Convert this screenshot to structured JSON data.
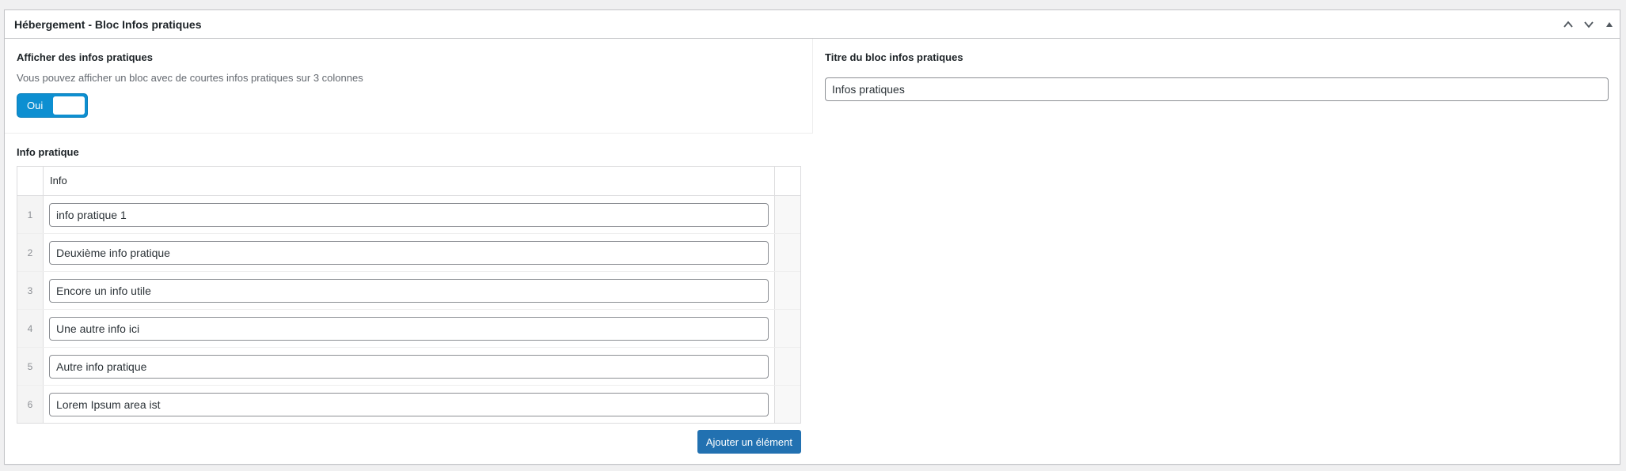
{
  "postbox": {
    "title": "Hébergement - Bloc Infos pratiques"
  },
  "toggle_field": {
    "label": "Afficher des infos pratiques",
    "description": "Vous pouvez afficher un bloc avec de courtes infos pratiques sur 3 colonnes",
    "on_text": "Oui",
    "checked": true
  },
  "title_field": {
    "label": "Titre du bloc infos pratiques",
    "value": "Infos pratiques"
  },
  "repeater": {
    "label": "Info pratique",
    "column_header": "Info",
    "rows": [
      {
        "order": "1",
        "value": "info pratique 1"
      },
      {
        "order": "2",
        "value": "Deuxième info pratique"
      },
      {
        "order": "3",
        "value": "Encore un info utile"
      },
      {
        "order": "4",
        "value": "Une autre info ici"
      },
      {
        "order": "5",
        "value": "Autre info pratique"
      },
      {
        "order": "6",
        "value": "Lorem Ipsum area ist"
      }
    ],
    "add_button": "Ajouter un élément"
  },
  "colors": {
    "primary": "#2271b1",
    "switch_on": "#0d8fd1",
    "border": "#c3c4c7"
  },
  "icons": {
    "move_up": "chevron-up-icon",
    "move_down": "chevron-down-icon",
    "toggle": "triangle-up-icon"
  }
}
